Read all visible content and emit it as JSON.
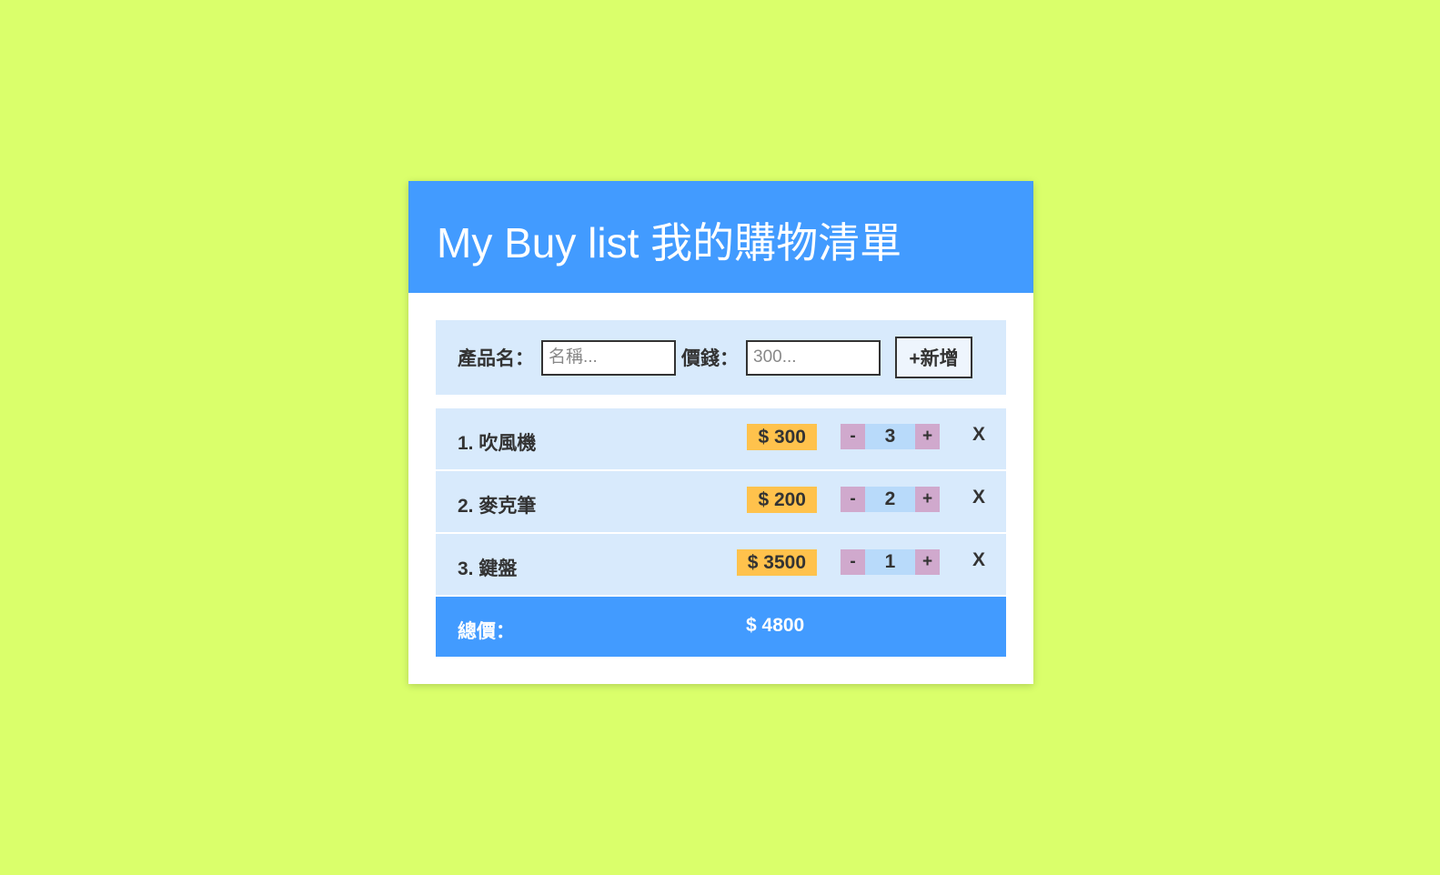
{
  "header": {
    "title": "My Buy list 我的購物清單"
  },
  "form": {
    "name_label": "產品名：",
    "name_placeholder": "名稱...",
    "price_label": "價錢：",
    "price_placeholder": "300...",
    "add_label": "+新增"
  },
  "items": [
    {
      "index": "1.",
      "name": "吹風機",
      "price": "$ 300",
      "qty": "3"
    },
    {
      "index": "2.",
      "name": "麥克筆",
      "price": "$ 200",
      "qty": "2"
    },
    {
      "index": "3.",
      "name": "鍵盤",
      "price": "$ 3500",
      "qty": "1"
    }
  ],
  "controls": {
    "minus": "-",
    "plus": "+",
    "remove": "X"
  },
  "total": {
    "label": "總價：",
    "value": "$ 4800"
  },
  "colors": {
    "background": "#daff6b",
    "header": "#429bff",
    "row": "#d8eafc",
    "price_tag": "#ffc24c",
    "qty_button": "#d0a9cd",
    "qty_value": "#b8dafa"
  }
}
